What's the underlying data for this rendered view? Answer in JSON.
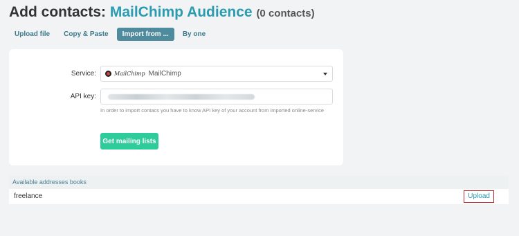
{
  "header": {
    "title_prefix": "Add contacts: ",
    "title_source": "MailChimp Audience",
    "contacts_count": "(0 contacts)"
  },
  "tabs": [
    {
      "label": "Upload file",
      "active": false
    },
    {
      "label": "Copy & Paste",
      "active": false
    },
    {
      "label": "Import from ...",
      "active": true
    },
    {
      "label": "By one",
      "active": false
    }
  ],
  "form": {
    "service_label": "Service:",
    "service_logo_text": "MailChimp",
    "service_value": "MailChimp",
    "api_key_label": "API key:",
    "api_key_hint": "In order to import contacs you have to know API key of your account from imported online-service",
    "submit_label": "Get mailing lists"
  },
  "address_books": {
    "header": "Available addresses books",
    "rows": [
      {
        "name": "freelance",
        "action_label": "Upload"
      }
    ]
  },
  "colors": {
    "accent": "#2a9bb0",
    "active_tab": "#4d8b9d",
    "primary_button": "#2ecc9a",
    "highlight_border": "#c0282d"
  },
  "icons": [
    "mailchimp-logo-icon",
    "chevron-down-icon"
  ]
}
